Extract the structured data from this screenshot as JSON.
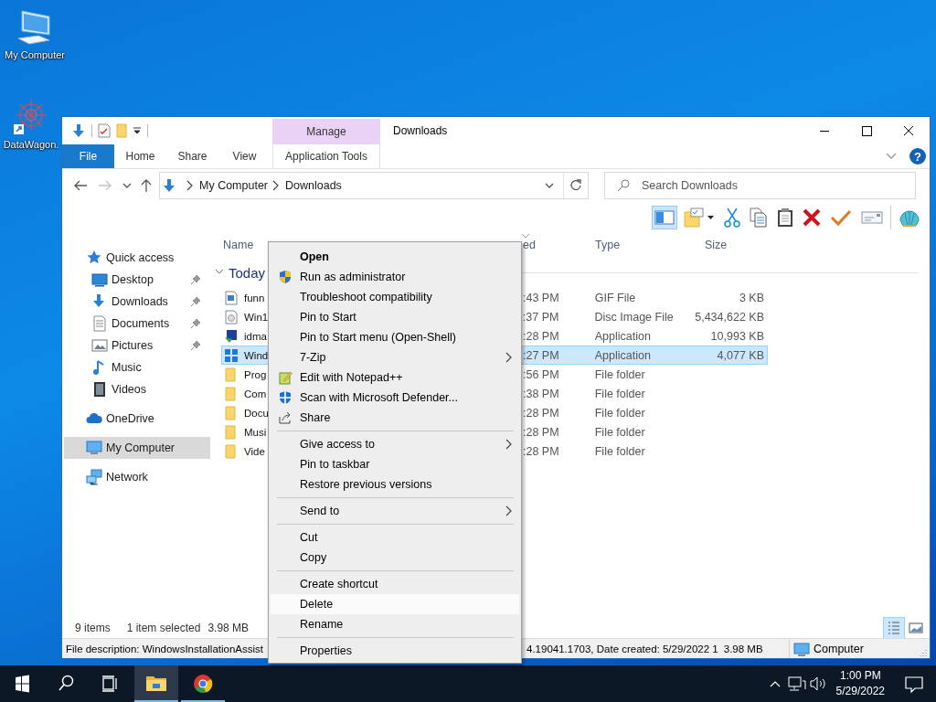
{
  "desktop_icons": [
    {
      "label": "My Computer",
      "kind": "computer"
    },
    {
      "label": "DataWagon.",
      "kind": "shortcut"
    }
  ],
  "window": {
    "title": "Downloads",
    "contextual_group": "Manage",
    "ribbon_tabs": [
      {
        "label": "File",
        "kind": "file"
      },
      {
        "label": "Home",
        "kind": "tab"
      },
      {
        "label": "Share",
        "kind": "tab"
      },
      {
        "label": "View",
        "kind": "tab"
      },
      {
        "label": "Application Tools",
        "kind": "contextual"
      }
    ],
    "help": "?",
    "address_bar": {
      "crumbs": [
        "My Computer",
        "Downloads"
      ]
    },
    "search": {
      "placeholder": "Search Downloads"
    },
    "toolbar": [
      {
        "selected": true
      },
      {
        "selected": false
      },
      {
        "selected": false
      },
      {
        "selected": false
      },
      {
        "selected": false
      },
      {
        "selected": false
      },
      {
        "selected": false
      },
      {
        "selected": false
      },
      {
        "selected": false
      }
    ],
    "navigation": [
      {
        "label": "Quick access",
        "selected": false,
        "children": [
          {
            "label": "Desktop",
            "pinned": true,
            "selected": false
          },
          {
            "label": "Downloads",
            "pinned": true,
            "selected": false
          },
          {
            "label": "Documents",
            "pinned": true,
            "selected": false
          },
          {
            "label": "Pictures",
            "pinned": true,
            "selected": false
          },
          {
            "label": "Music",
            "pinned": false,
            "selected": false
          },
          {
            "label": "Videos",
            "pinned": false,
            "selected": false
          }
        ]
      },
      {
        "label": "OneDrive",
        "selected": false
      },
      {
        "label": "My Computer",
        "selected": true
      },
      {
        "label": "Network",
        "selected": false
      }
    ],
    "file_list": {
      "columns": {
        "name": "Name",
        "column_2": "ed",
        "type": "Type",
        "size": "Size"
      },
      "group": "Today",
      "rows": [
        {
          "name": "funn",
          "column_2": ":43 PM",
          "type": "GIF File",
          "size": "3 KB",
          "selected": false
        },
        {
          "name": "Win1",
          "column_2": ":37 PM",
          "type": "Disc Image File",
          "size": "5,434,622 KB",
          "selected": false
        },
        {
          "name": "idma",
          "column_2": ":28 PM",
          "type": "Application",
          "size": "10,993 KB",
          "selected": false
        },
        {
          "name": "Wind",
          "column_2": ":27 PM",
          "type": "Application",
          "size": "4,077 KB",
          "selected": true
        },
        {
          "name": "Prog",
          "column_2": ":56 PM",
          "type": "File folder",
          "selected": false
        },
        {
          "name": "Com",
          "column_2": ":38 PM",
          "type": "File folder",
          "selected": false
        },
        {
          "name": "Docu",
          "column_2": ":28 PM",
          "type": "File folder",
          "selected": false
        },
        {
          "name": "Musi",
          "column_2": ":28 PM",
          "type": "File folder",
          "selected": false
        },
        {
          "name": "Vide",
          "column_2": ":28 PM",
          "type": "File folder",
          "selected": false
        }
      ]
    },
    "status": {
      "item_count": "9 items",
      "selection": "1 item selected",
      "selection_size": "3.98 MB",
      "views": [
        {
          "selected": true
        },
        {
          "selected": false
        }
      ]
    },
    "classic_status_bar": {
      "description": "File description: WindowsInstallationAssist",
      "details": "4.19041.1703, Date created: 5/29/2022 1",
      "size": "3.98 MB",
      "zone": "Computer"
    }
  },
  "context_menu": {
    "items": [
      {
        "kind": "item",
        "label": "Open",
        "default": true,
        "submenu": false,
        "selected": false
      },
      {
        "kind": "item",
        "label": "Run as administrator",
        "default": false,
        "submenu": false,
        "selected": false
      },
      {
        "kind": "item",
        "label": "Troubleshoot compatibility",
        "default": false,
        "submenu": false,
        "selected": false
      },
      {
        "kind": "item",
        "label": "Pin to Start",
        "default": false,
        "submenu": false,
        "selected": false
      },
      {
        "kind": "item",
        "label": "Pin to Start menu (Open-Shell)",
        "default": false,
        "submenu": false,
        "selected": false
      },
      {
        "kind": "item",
        "label": "7-Zip",
        "default": false,
        "submenu": true,
        "selected": false
      },
      {
        "kind": "item",
        "label": "Edit with Notepad++",
        "default": false,
        "submenu": false,
        "selected": false
      },
      {
        "kind": "item",
        "label": "Scan with Microsoft Defender...",
        "default": false,
        "submenu": false,
        "selected": false
      },
      {
        "kind": "item",
        "label": "Share",
        "default": false,
        "submenu": false,
        "selected": false
      },
      {
        "kind": "separator"
      },
      {
        "kind": "item",
        "label": "Give access to",
        "default": false,
        "submenu": true,
        "selected": false
      },
      {
        "kind": "item",
        "label": "Pin to taskbar",
        "default": false,
        "submenu": false,
        "selected": false
      },
      {
        "kind": "item",
        "label": "Restore previous versions",
        "default": false,
        "submenu": false,
        "selected": false
      },
      {
        "kind": "separator"
      },
      {
        "kind": "item",
        "label": "Send to",
        "default": false,
        "submenu": true,
        "selected": false
      },
      {
        "kind": "separator"
      },
      {
        "kind": "item",
        "label": "Cut",
        "default": false,
        "submenu": false,
        "selected": false
      },
      {
        "kind": "item",
        "label": "Copy",
        "default": false,
        "submenu": false,
        "selected": false
      },
      {
        "kind": "separator"
      },
      {
        "kind": "item",
        "label": "Create shortcut",
        "default": false,
        "submenu": false,
        "selected": false
      },
      {
        "kind": "item",
        "label": "Delete",
        "default": false,
        "submenu": false,
        "selected": true
      },
      {
        "kind": "item",
        "label": "Rename",
        "default": false,
        "submenu": false,
        "selected": false
      },
      {
        "kind": "separator"
      },
      {
        "kind": "item",
        "label": "Properties",
        "default": false,
        "submenu": false,
        "selected": false
      }
    ]
  },
  "taskbar": {
    "apps": [
      {
        "running": true,
        "active": true
      },
      {
        "running": true,
        "active": false
      }
    ],
    "clock": {
      "time": "1:00 PM",
      "date": "5/29/2022"
    }
  }
}
